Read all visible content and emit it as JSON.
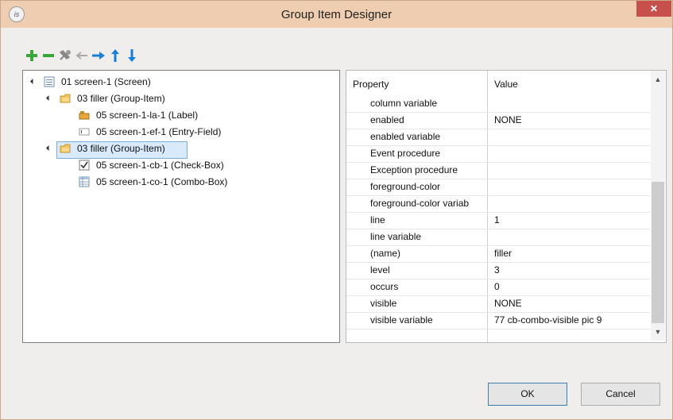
{
  "window": {
    "title": "Group Item Designer",
    "close_glyph": "✕",
    "app_icon_text": "is"
  },
  "toolbar": {
    "buttons": [
      {
        "name": "add-button",
        "icon": "plus-icon",
        "color": "#3aa63a"
      },
      {
        "name": "remove-button",
        "icon": "minus-icon",
        "color": "#3aa63a"
      },
      {
        "name": "delete-all-button",
        "icon": "wrench-x-icon",
        "color": "#888888"
      },
      {
        "name": "outdent-button",
        "icon": "arrow-left-icon",
        "color": "#aaaaaa"
      },
      {
        "name": "indent-button",
        "icon": "arrow-right-icon",
        "color": "#1a7fd6"
      },
      {
        "name": "move-up-button",
        "icon": "arrow-up-icon",
        "color": "#1a7fd6"
      },
      {
        "name": "move-down-button",
        "icon": "arrow-down-icon",
        "color": "#1a7fd6"
      }
    ]
  },
  "tree": {
    "items": [
      {
        "label": "01 screen-1 (Screen)",
        "icon": "screen-icon",
        "expanded": true
      },
      {
        "label": "03 filler (Group-Item)",
        "icon": "folder-icon",
        "expanded": true
      },
      {
        "label": "05 screen-1-la-1 (Label)",
        "icon": "label-icon"
      },
      {
        "label": "05 screen-1-ef-1 (Entry-Field)",
        "icon": "entry-field-icon"
      },
      {
        "label": "03 filler (Group-Item)",
        "icon": "folder-icon",
        "expanded": true,
        "selected": true
      },
      {
        "label": "05 screen-1-cb-1 (Check-Box)",
        "icon": "checkbox-icon"
      },
      {
        "label": "05 screen-1-co-1 (Combo-Box)",
        "icon": "combo-box-icon"
      }
    ]
  },
  "properties": {
    "header": {
      "property": "Property",
      "value": "Value"
    },
    "rows": [
      {
        "name": "column variable",
        "value": ""
      },
      {
        "name": "enabled",
        "value": "NONE"
      },
      {
        "name": "enabled variable",
        "value": ""
      },
      {
        "name": "Event procedure",
        "value": ""
      },
      {
        "name": "Exception procedure",
        "value": ""
      },
      {
        "name": "foreground-color",
        "value": ""
      },
      {
        "name": "foreground-color variab",
        "value": ""
      },
      {
        "name": "line",
        "value": "1"
      },
      {
        "name": "line variable",
        "value": ""
      },
      {
        "name": "(name)",
        "value": "filler"
      },
      {
        "name": "level",
        "value": "3"
      },
      {
        "name": "occurs",
        "value": "0"
      },
      {
        "name": "visible",
        "value": "NONE"
      },
      {
        "name": "visible variable",
        "value": "77 cb-combo-visible pic 9"
      }
    ]
  },
  "footer": {
    "ok_label": "OK",
    "cancel_label": "Cancel"
  },
  "colors": {
    "title_bar": "#eecdb0",
    "close_button": "#c74f4c",
    "selection": "#d8eafb"
  }
}
